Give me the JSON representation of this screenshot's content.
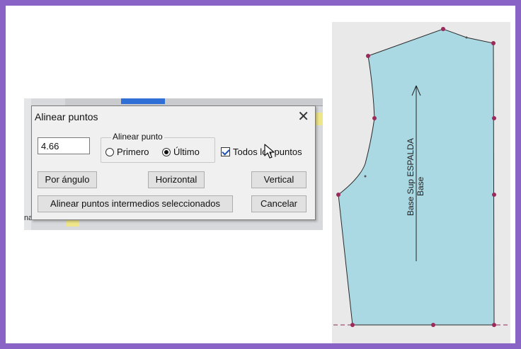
{
  "dialog": {
    "title": "Alinear puntos",
    "close_symbol": "✕",
    "value": "4.66",
    "group_label": "Alinear punto",
    "radio_first": "Primero",
    "radio_last": "Último",
    "radio_selected": "Último",
    "checkbox_label": "Todos los puntos",
    "checkbox_checked": true,
    "buttons": {
      "by_angle": "Por ángulo",
      "horizontal": "Horizontal",
      "vertical": "Vertical",
      "align_intermediate": "Alinear puntos intermedios seleccionados",
      "cancel": "Cancelar"
    }
  },
  "background": {
    "left_fragment_text": "na"
  },
  "pattern": {
    "piece_label_line1": "Base Sup ESPALDA",
    "piece_label_line2": "Base",
    "fill_color": "#aad9e3",
    "point_color": "#9b2a5a"
  },
  "colors": {
    "frame_border": "#8a63c6"
  }
}
